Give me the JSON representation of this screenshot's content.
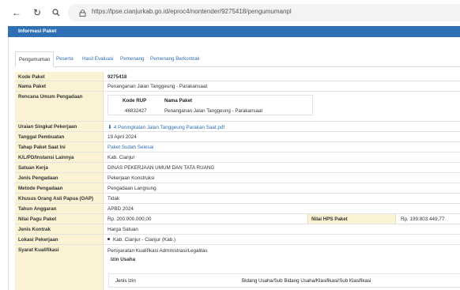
{
  "browser": {
    "url": "https://lpse.cianjurkab.go.id/eproc4/nontender/9275418/pengumumanpl"
  },
  "panel": {
    "title": "Informasi Paket"
  },
  "tabs": [
    {
      "label": "Pengumuman"
    },
    {
      "label": "Peserta"
    },
    {
      "label": "Hasil Evaluasi"
    },
    {
      "label": "Pemenang"
    },
    {
      "label": "Pemenang Berkontrak"
    }
  ],
  "rows": {
    "kode_paket": {
      "label": "Kode Paket",
      "value": "9275418"
    },
    "nama_paket": {
      "label": "Nama Paket",
      "value": "Penanganan Jalan Tanggeung - Parakansaat"
    },
    "rup": {
      "label": "Rencana Umum Pengadaan",
      "col_kode": "Kode RUP",
      "col_nama": "Nama Paket",
      "kode": "46832427",
      "nama": "Penanganan Jalan Tanggeung - Parakansaat"
    },
    "uraian": {
      "label": "Uraian Singkat Pekerjaan",
      "value": "4 Peningkatan Jalan Tanggeung Parakan Saat.pdf"
    },
    "tanggal": {
      "label": "Tanggal Pembuatan",
      "value": "19 April 2024"
    },
    "tahap": {
      "label": "Tahap Paket Saat Ini",
      "value": "Paket Sudah Selesai"
    },
    "klpd": {
      "label": "K/L/PD/Instansi Lainnya",
      "value": "Kab. Cianjur"
    },
    "satker": {
      "label": "Satuan Kerja",
      "value": "DINAS PEKERJAAN UMUM DAN TATA RUANG"
    },
    "jenis": {
      "label": "Jenis Pengadaan",
      "value": "Pekerjaan Konstruksi"
    },
    "metode": {
      "label": "Metode Pengadaan",
      "value": "Pengadaan Langsung"
    },
    "oap": {
      "label": "Khusus Orang Asli Papua (OAP)",
      "value": "Tidak"
    },
    "tahun": {
      "label": "Tahun Anggaran",
      "value": "APBD 2024"
    },
    "pagu": {
      "label": "Nilai Pagu Paket",
      "value": "Rp. 200.000.000,00",
      "hps_label": "Nilai HPS Paket",
      "hps_value": "Rp. 199.803.449,77"
    },
    "kontrak": {
      "label": "Jenis Kontrak",
      "value": "Harga Satuan"
    },
    "lokasi": {
      "label": "Lokasi Pekerjaan",
      "value": "Kab. Cianjur - Cianjur (Kab.)"
    },
    "syarat": {
      "label": "Syarat Kualifikasi",
      "value": "Persyaratan Kualifikasi Administrasi/Legalitas",
      "izin_usaha": "Izin Usaha",
      "col_jenis": "Jenis Izin",
      "col_bidang": "Bidang Usaha/Sub Bidang Usaha/Klasifikasi/Sub Klasifikasi"
    }
  }
}
